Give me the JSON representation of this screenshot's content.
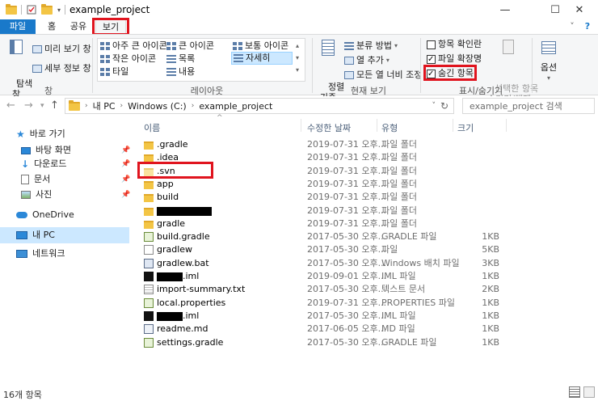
{
  "window": {
    "title": "example_project",
    "minimize": "—",
    "maximize": "☐",
    "close": "✕"
  },
  "tabs": {
    "file": "파일",
    "home": "홈",
    "share": "공유",
    "view": "보기",
    "collapse": "˅",
    "help": "?"
  },
  "ribbon": {
    "pane": {
      "nav_pane": "탐색\n창",
      "preview": "미리 보기 창",
      "details": "세부 정보 창",
      "label": "창"
    },
    "layout": {
      "extra_large": "아주 큰 아이콘",
      "large": "큰 아이콘",
      "medium": "보통 아이콘",
      "small": "작은 아이콘",
      "list": "목록",
      "details": "자세히",
      "tiles": "타일",
      "content": "내용",
      "label": "레이아웃"
    },
    "current_view": {
      "sort": "정렬\n기준",
      "group_by": "분류 방법",
      "add_columns": "열 추가",
      "fit_columns": "모든 열 너비 조정",
      "label": "현재 보기"
    },
    "show_hide": {
      "item_checkboxes": "항목 확인란",
      "file_extensions": "파일 확장명",
      "hidden_items": "숨긴 항목",
      "hide_selected": "선택한 항목\n숨기기/해제",
      "label": "표시/숨기기",
      "item_checkboxes_checked": false,
      "file_extensions_checked": true,
      "hidden_items_checked": true
    },
    "options": "옵션"
  },
  "address": {
    "path": [
      "내 PC",
      "Windows (C:)",
      "example_project"
    ],
    "search_placeholder": "example_project 검색"
  },
  "nav": {
    "quick_access": "바로 가기",
    "desktop": "바탕 화면",
    "downloads": "다운로드",
    "documents": "문서",
    "pictures": "사진",
    "onedrive": "OneDrive",
    "this_pc": "내 PC",
    "network": "네트워크"
  },
  "columns": {
    "name": "이름",
    "date": "수정한 날짜",
    "type": "유형",
    "size": "크기"
  },
  "files": [
    {
      "name": ".gradle",
      "date": "2019-07-31 오후...",
      "type": "파일 폴더",
      "size": "",
      "icon": "folder"
    },
    {
      "name": ".idea",
      "date": "2019-07-31 오후...",
      "type": "파일 폴더",
      "size": "",
      "icon": "folder"
    },
    {
      "name": ".svn",
      "date": "2019-07-31 오후...",
      "type": "파일 폴더",
      "size": "",
      "icon": "folder-light"
    },
    {
      "name": "app",
      "date": "2019-07-31 오후...",
      "type": "파일 폴더",
      "size": "",
      "icon": "folder"
    },
    {
      "name": "build",
      "date": "2019-07-31 오후...",
      "type": "파일 폴더",
      "size": "",
      "icon": "folder"
    },
    {
      "name": "",
      "date": "2019-07-31 오후...",
      "type": "파일 폴더",
      "size": "",
      "icon": "folder",
      "redacted": true
    },
    {
      "name": "gradle",
      "date": "2019-07-31 오후...",
      "type": "파일 폴더",
      "size": "",
      "icon": "folder"
    },
    {
      "name": "build.gradle",
      "date": "2017-05-30 오후...",
      "type": "GRADLE 파일",
      "size": "1KB",
      "icon": "gradle"
    },
    {
      "name": "gradlew",
      "date": "2017-05-30 오후...",
      "type": "파일",
      "size": "5KB",
      "icon": "file"
    },
    {
      "name": "gradlew.bat",
      "date": "2017-05-30 오후...",
      "type": "Windows 배치 파일",
      "size": "3KB",
      "icon": "bat"
    },
    {
      "name": ".iml",
      "date": "2019-09-01 오후...",
      "type": "IML 파일",
      "size": "1KB",
      "icon": "iml",
      "redacted": true
    },
    {
      "name": "import-summary.txt",
      "date": "2017-05-30 오후...",
      "type": "텍스트 문서",
      "size": "2KB",
      "icon": "txt"
    },
    {
      "name": "local.properties",
      "date": "2019-07-31 오후...",
      "type": "PROPERTIES 파일",
      "size": "1KB",
      "icon": "prop"
    },
    {
      "name": ".iml",
      "date": "2017-05-30 오후...",
      "type": "IML 파일",
      "size": "1KB",
      "icon": "iml",
      "redacted": true
    },
    {
      "name": "readme.md",
      "date": "2017-06-05 오후...",
      "type": "MD 파일",
      "size": "1KB",
      "icon": "md"
    },
    {
      "name": "settings.gradle",
      "date": "2017-05-30 오후...",
      "type": "GRADLE 파일",
      "size": "1KB",
      "icon": "gradle"
    }
  ],
  "status": {
    "count": "16개 항목"
  }
}
